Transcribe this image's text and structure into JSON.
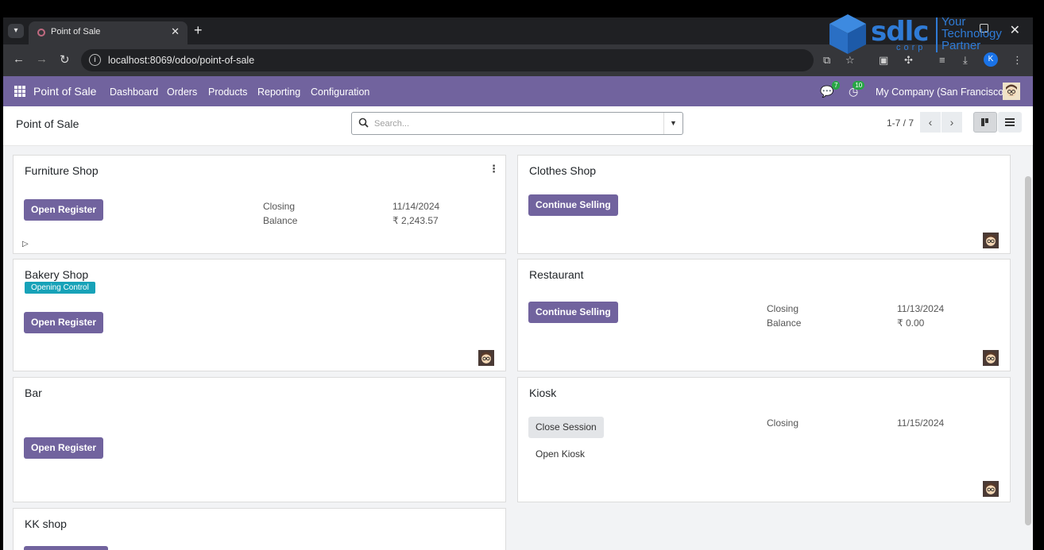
{
  "browser": {
    "tab_title": "Point of Sale",
    "url": "localhost:8069/odoo/point-of-sale",
    "profile_initial": "K"
  },
  "watermark": {
    "brand": "sdlc",
    "corp": "corp",
    "tagline": "Your Technology Partner"
  },
  "navbar": {
    "brand": "Point of Sale",
    "menus": [
      "Dashboard",
      "Orders",
      "Products",
      "Reporting",
      "Configuration"
    ],
    "messages_count": "7",
    "activities_count": "10",
    "company": "My Company (San Francisco)"
  },
  "control": {
    "breadcrumb": "Point of Sale",
    "search_placeholder": "Search...",
    "pager": "1-7 / 7"
  },
  "cards": {
    "furniture": {
      "title": "Furniture Shop",
      "button": "Open Register",
      "closing_label": "Closing",
      "closing_value": "11/14/2024",
      "balance_label": "Balance",
      "balance_value": "₹ 2,243.57"
    },
    "clothes": {
      "title": "Clothes Shop",
      "button": "Continue Selling"
    },
    "bakery": {
      "title": "Bakery Shop",
      "tag": "Opening Control",
      "button": "Open Register"
    },
    "restaurant": {
      "title": "Restaurant",
      "button": "Continue Selling",
      "closing_label": "Closing",
      "closing_value": "11/13/2024",
      "balance_label": "Balance",
      "balance_value": "₹ 0.00"
    },
    "bar": {
      "title": "Bar",
      "button": "Open Register"
    },
    "kiosk": {
      "title": "Kiosk",
      "button": "Close Session",
      "link": "Open Kiosk",
      "closing_label": "Closing",
      "closing_value": "11/15/2024"
    },
    "kk": {
      "title": "KK shop"
    }
  },
  "colors": {
    "odoo_primary": "#71639e",
    "tag_teal": "#17a2b8",
    "badge_green": "#28a745"
  }
}
